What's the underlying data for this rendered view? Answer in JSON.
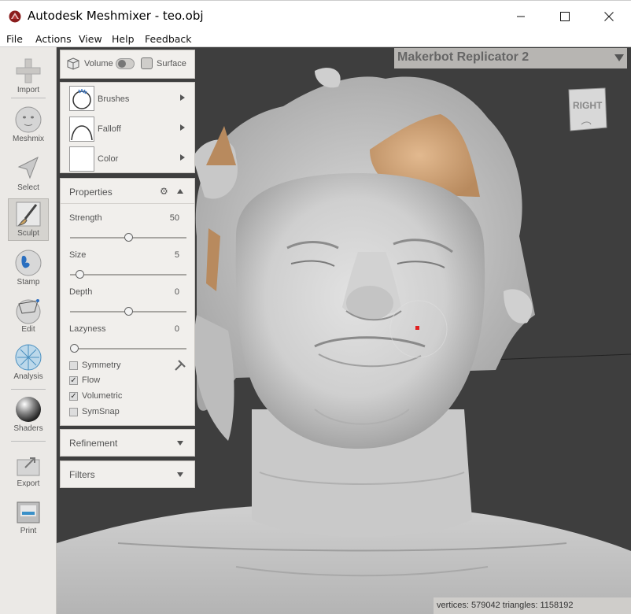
{
  "window": {
    "title": "Autodesk Meshmixer - teo.obj",
    "minimize_icon": "minimize-icon",
    "maximize_icon": "maximize-icon",
    "close_icon": "close-icon"
  },
  "menu": [
    "File",
    "Actions",
    "View",
    "Help",
    "Feedback"
  ],
  "tools": [
    {
      "label": "Import",
      "icon": "plus-icon"
    },
    {
      "label": "Meshmix",
      "icon": "face-icon"
    },
    {
      "label": "Select",
      "icon": "arrow-cursor-icon"
    },
    {
      "label": "Sculpt",
      "icon": "brush-icon",
      "active": true
    },
    {
      "label": "Stamp",
      "icon": "stamp-icon"
    },
    {
      "label": "Edit",
      "icon": "edit-sphere-icon"
    },
    {
      "label": "Analysis",
      "icon": "analysis-sphere-icon"
    },
    {
      "label": "Shaders",
      "icon": "chrome-sphere-icon"
    },
    {
      "label": "Export",
      "icon": "export-icon"
    },
    {
      "label": "Print",
      "icon": "printer-icon"
    }
  ],
  "mode": {
    "volume_label": "Volume",
    "surface_label": "Surface"
  },
  "brush_panel": {
    "brushes_label": "Brushes",
    "falloff_label": "Falloff",
    "color_label": "Color"
  },
  "properties": {
    "title": "Properties",
    "sliders": [
      {
        "label": "Strength",
        "value": "50",
        "fraction": 0.5
      },
      {
        "label": "Size",
        "value": "5",
        "fraction": 0.05
      },
      {
        "label": "Depth",
        "value": "0",
        "fraction": 0.5
      },
      {
        "label": "Lazyness",
        "value": "0",
        "fraction": 0.0
      }
    ],
    "checkboxes": [
      {
        "label": "Symmetry",
        "checked": false
      },
      {
        "label": "Flow",
        "checked": true
      },
      {
        "label": "Volumetric",
        "checked": true
      },
      {
        "label": "SymSnap",
        "checked": false
      }
    ]
  },
  "refinement": {
    "title": "Refinement"
  },
  "filters": {
    "title": "Filters"
  },
  "printer": {
    "name": "Makerbot Replicator 2"
  },
  "view_cube": {
    "label": "RIGHT"
  },
  "status": {
    "text": "vertices: 579042 triangles: 1158192"
  },
  "colors": {
    "skin_patch": "#c89a6e",
    "mesh": "#d4d4d4",
    "background": "#3e3e3e",
    "panel": "#f1efec"
  }
}
